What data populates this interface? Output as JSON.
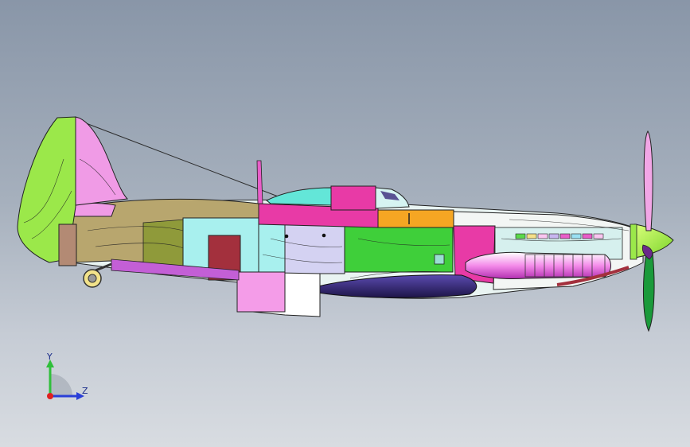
{
  "viewport": {
    "background_top": "#8996a8",
    "background_bottom": "#d8dce1"
  },
  "model": {
    "icon": "aircraft-model",
    "colors": {
      "tail_fin": "#9be84a",
      "rudder": "#f09be6",
      "fuselage_rear": "#b8a66e",
      "fuselage_mid": "#a8f0ee",
      "panel_green": "#3fcf3a",
      "panel_magenta": "#e83aa6",
      "panel_orange": "#f5a623",
      "canopy": "#63e6d8",
      "wing_pink": "#f49ce8",
      "belly_navy": "#3a2b7a",
      "spinner": "#a4f03a",
      "propeller_pink": "#f2a6e6",
      "propeller_green": "#1a9a3a",
      "door_red": "#a3303d",
      "stripe_purple": "#c35fd6"
    }
  },
  "triad": {
    "icon": "coordinate-triad",
    "y_label": "Y",
    "z_label": "Z",
    "y_color": "#2fbf3a",
    "z_color": "#2a3fd8",
    "origin_color": "#e02020"
  }
}
